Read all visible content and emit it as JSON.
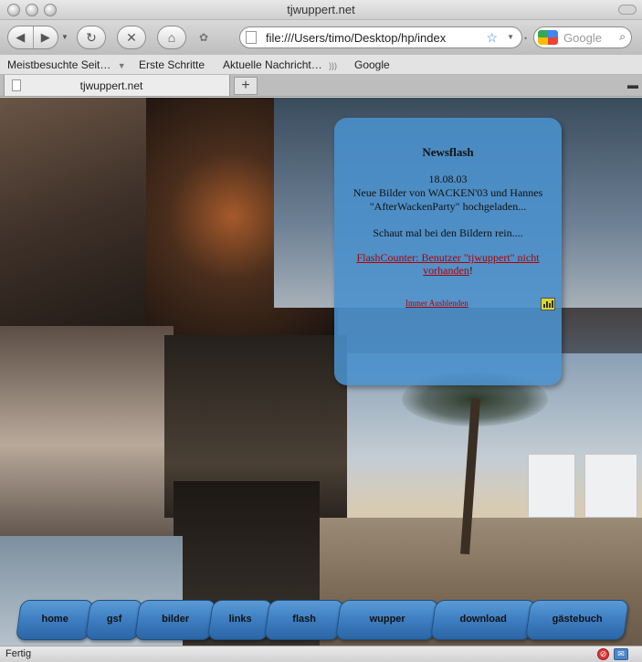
{
  "window": {
    "title": "tjwuppert.net"
  },
  "toolbar": {
    "back_icon": "back-arrow-icon",
    "forward_icon": "forward-arrow-icon",
    "url": "file:///Users/timo/Desktop/hp/index",
    "search_placeholder": "Google"
  },
  "bookmarks": [
    {
      "label": "Meistbesuchte Seit…"
    },
    {
      "label": "Erste Schritte"
    },
    {
      "label": "Aktuelle Nachricht…"
    },
    {
      "label": "Google"
    }
  ],
  "tabs": [
    {
      "label": "tjwuppert.net"
    }
  ],
  "news": {
    "title": "Newsflash",
    "date": "18.08.03",
    "body": "Neue Bilder von WACKEN'03 und Hannes \"AfterWackenParty\" hochgeladen...",
    "sub": "Schaut mal bei den Bildern rein....",
    "counter_link": "FlashCounter: Benutzer \"tjwuppert\" nicht vorhanden",
    "counter_tail": "!",
    "hide_link": "Immer Ausblenden"
  },
  "nav": [
    {
      "label": "home"
    },
    {
      "label": "gsf"
    },
    {
      "label": "bilder"
    },
    {
      "label": "links"
    },
    {
      "label": "flash"
    },
    {
      "label": "wupper"
    },
    {
      "label": "download"
    },
    {
      "label": "gästebuch"
    }
  ],
  "status": {
    "text": "Fertig"
  }
}
